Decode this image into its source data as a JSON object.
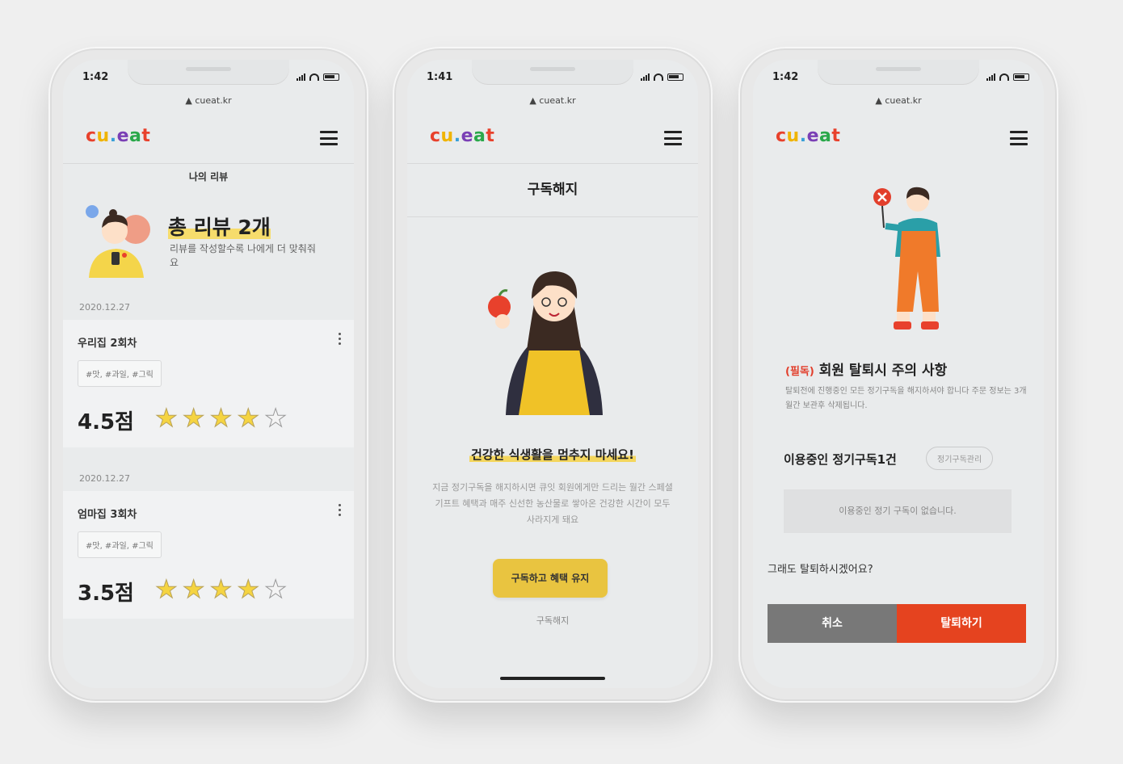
{
  "status": {
    "p1_time": "1:42",
    "p2_time": "1:41",
    "p3_time": "1:42"
  },
  "browser": {
    "url": "▲ cueat.kr"
  },
  "brand": {
    "logo_parts": [
      "c",
      "u",
      ".",
      "e",
      "a",
      "t"
    ],
    "colors": {
      "red": "#e8412c",
      "yellow": "#f0b400",
      "blue": "#3aa0d8",
      "purple": "#7a3fb5",
      "green": "#2aa84a"
    }
  },
  "phone1": {
    "page_title": "나의 리뷰",
    "total_reviews": "총 리뷰 2개",
    "total_sub": "리뷰를 작성할수록 나에게 더 맞춰줘요",
    "reviews": [
      {
        "date": "2020.12.27",
        "title": "우리집 2회차",
        "tags": "#맛, #과일, #그릭",
        "score": "4.5점",
        "rating": 4.5
      },
      {
        "date": "2020.12.27",
        "title": "엄마집 3회차",
        "tags": "#맛, #과일, #그릭",
        "score": "3.5점",
        "rating": 3.5
      }
    ]
  },
  "phone2": {
    "page_title": "구독해지",
    "headline": "건강한 식생활을 멈추지 마세요!",
    "desc": "지금 정기구독을 해지하시면 큐잇 회원에게만 드리는 월간 스페셜 기프트 혜택과 매주 신선한 농산물로 쌓아온 건강한 시간이 모두 사라지게 돼요",
    "keep_button": "구독하고 혜택 유지",
    "cancel_link": "구독해지"
  },
  "phone3": {
    "required": "(필독)",
    "warning_title": "회원 탈퇴시 주의 사항",
    "warning_desc": "탈퇴전에 진행중인 모든 정기구독을 해지하셔야 합니다 주문 정보는 3개월간 보관후 삭제됩니다.",
    "active_label": "이용중인 정기구독1건",
    "manage_button": "정기구독관리",
    "no_sub": "이용중인 정기 구독이 없습니다.",
    "confirm": "그래도 탈퇴하시겠어요?",
    "cancel_button": "취소",
    "leave_button": "탈퇴하기"
  }
}
